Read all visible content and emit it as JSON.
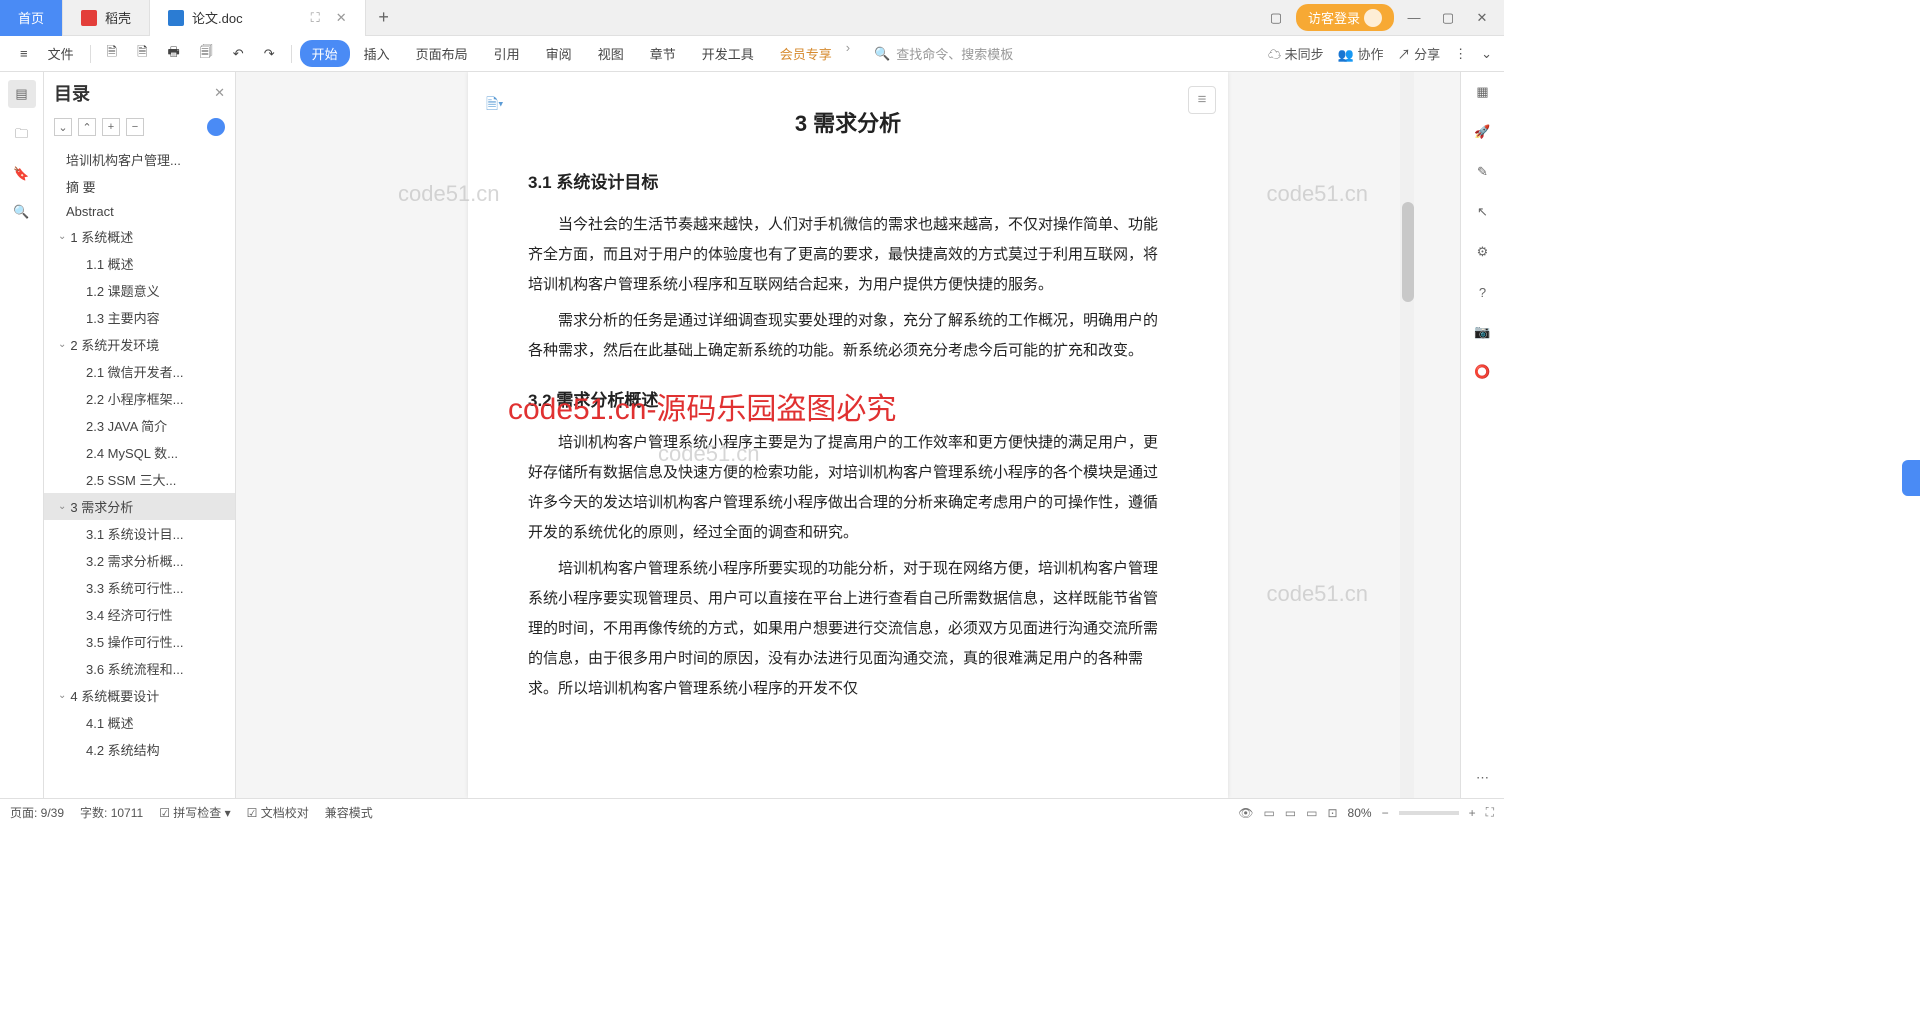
{
  "tabs": {
    "home": "首页",
    "docker": "稻壳",
    "doc": "论文.doc"
  },
  "login": "访客登录",
  "fileMenu": "文件",
  "ribbon": {
    "start": "开始",
    "insert": "插入",
    "layout": "页面布局",
    "reference": "引用",
    "review": "审阅",
    "view": "视图",
    "chapter": "章节",
    "devtools": "开发工具",
    "vip": "会员专享"
  },
  "search": "查找命令、搜索模板",
  "rightActions": {
    "sync": "未同步",
    "collab": "协作",
    "share": "分享"
  },
  "outline": {
    "title": "目录",
    "items": [
      {
        "label": "培训机构客户管理...",
        "lvl": 0
      },
      {
        "label": "摘 要",
        "lvl": 0
      },
      {
        "label": "Abstract",
        "lvl": 0
      },
      {
        "label": "1  系统概述",
        "lvl": 1,
        "exp": true
      },
      {
        "label": "1.1 概述",
        "lvl": 2
      },
      {
        "label": "1.2 课题意义",
        "lvl": 2
      },
      {
        "label": "1.3 主要内容",
        "lvl": 2
      },
      {
        "label": "2  系统开发环境",
        "lvl": 1,
        "exp": true
      },
      {
        "label": "2.1 微信开发者...",
        "lvl": 2
      },
      {
        "label": "2.2 小程序框架...",
        "lvl": 2
      },
      {
        "label": "2.3 JAVA 简介",
        "lvl": 2
      },
      {
        "label": "2.4 MySQL 数...",
        "lvl": 2
      },
      {
        "label": "2.5 SSM 三大...",
        "lvl": 2
      },
      {
        "label": "3  需求分析",
        "lvl": 1,
        "exp": true,
        "sel": true
      },
      {
        "label": "3.1 系统设计目...",
        "lvl": 2
      },
      {
        "label": "3.2 需求分析概...",
        "lvl": 2
      },
      {
        "label": "3.3 系统可行性...",
        "lvl": 2
      },
      {
        "label": "3.4 经济可行性",
        "lvl": 2
      },
      {
        "label": "3.5 操作可行性...",
        "lvl": 2
      },
      {
        "label": "3.6 系统流程和...",
        "lvl": 2
      },
      {
        "label": "4 系统概要设计",
        "lvl": 1,
        "exp": true
      },
      {
        "label": "4.1 概述",
        "lvl": 2
      },
      {
        "label": "4.2 系统结构",
        "lvl": 2
      }
    ]
  },
  "doc": {
    "chapterTitle": "3  需求分析",
    "s31": "3.1  系统设计目标",
    "p1": "当今社会的生活节奏越来越快，人们对手机微信的需求也越来越高，不仅对操作简单、功能齐全方面，而且对于用户的体验度也有了更高的要求，最快捷高效的方式莫过于利用互联网，将培训机构客户管理系统小程序和互联网结合起来，为用户提供方便快捷的服务。",
    "p2": "需求分析的任务是通过详细调查现实要处理的对象，充分了解系统的工作概况，明确用户的各种需求，然后在此基础上确定新系统的功能。新系统必须充分考虑今后可能的扩充和改变。",
    "s32": "3.2 需求分析概述",
    "p3": "培训机构客户管理系统小程序主要是为了提高用户的工作效率和更方便快捷的满足用户，更好存储所有数据信息及快速方便的检索功能，对培训机构客户管理系统小程序的各个模块是通过许多今天的发达培训机构客户管理系统小程序做出合理的分析来确定考虑用户的可操作性，遵循开发的系统优化的原则，经过全面的调查和研究。",
    "p4": "培训机构客户管理系统小程序所要实现的功能分析，对于现在网络方便，培训机构客户管理系统小程序要实现管理员、用户可以直接在平台上进行查看自己所需数据信息，这样既能节省管理的时间，不用再像传统的方式，如果用户想要进行交流信息，必须双方见面进行沟通交流所需的信息，由于很多用户时间的原因，没有办法进行见面沟通交流，真的很难满足用户的各种需求。所以培训机构客户管理系统小程序的开发不仅"
  },
  "watermark": {
    "text": "code51.cn",
    "red": "code51.cn-源码乐园盗图必究"
  },
  "status": {
    "page": "页面: 9/39",
    "words": "字数: 10711",
    "spell": "拼写检查",
    "proof": "文档校对",
    "compat": "兼容模式",
    "zoom": "80%"
  }
}
